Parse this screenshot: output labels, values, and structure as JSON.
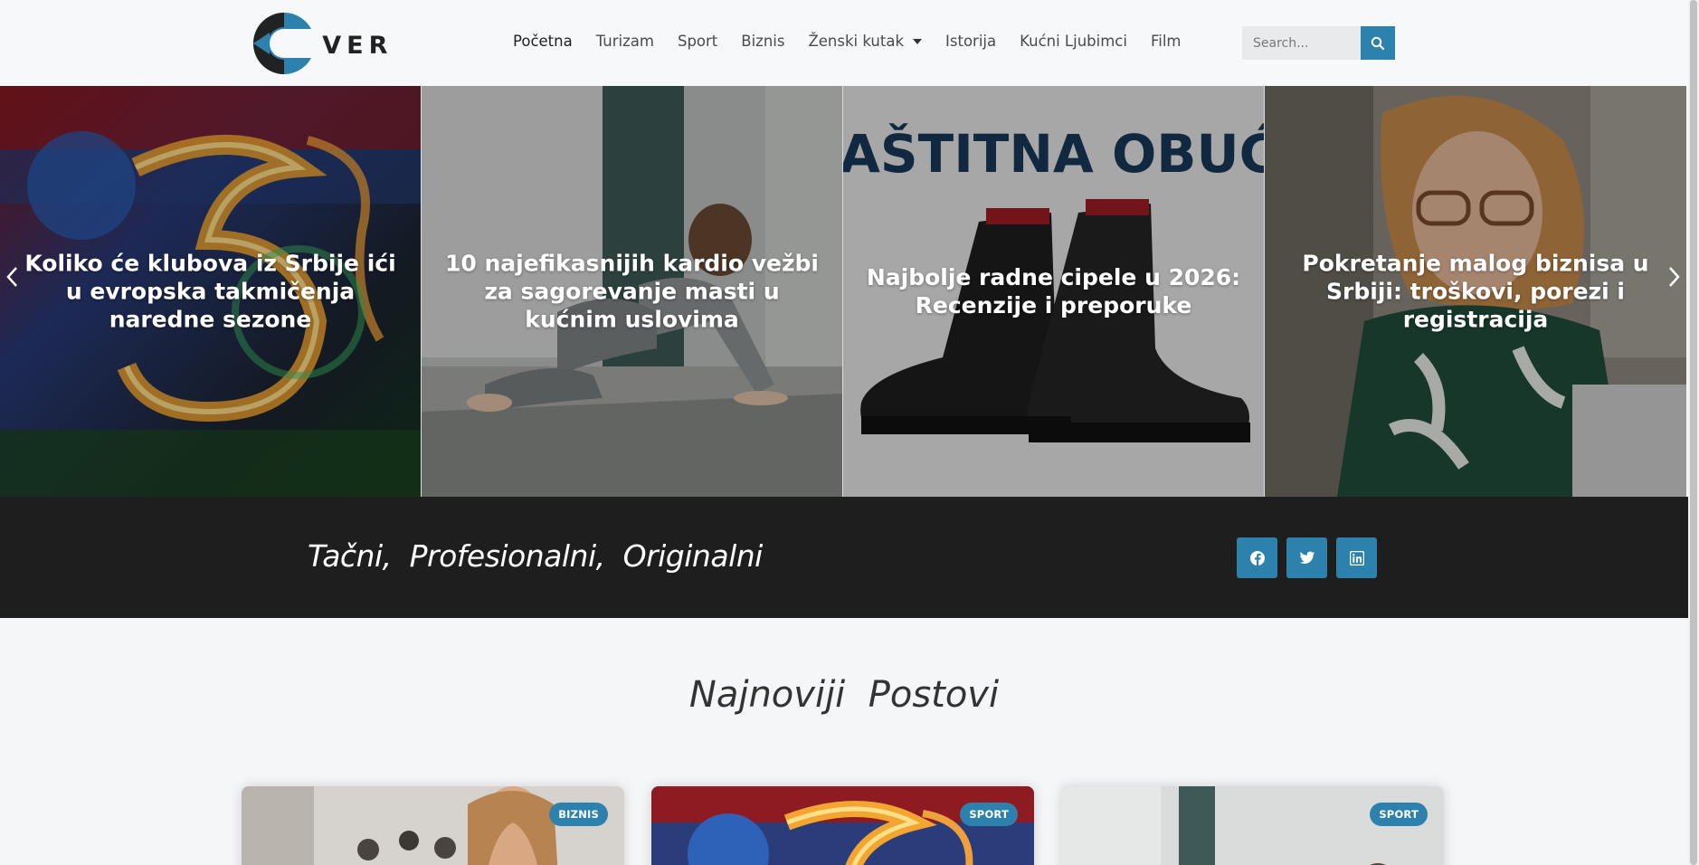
{
  "header": {
    "logo_text": "OVER",
    "nav": [
      {
        "label": "Početna",
        "active": true
      },
      {
        "label": "Turizam"
      },
      {
        "label": "Sport"
      },
      {
        "label": "Biznis"
      },
      {
        "label": "Ženski kutak",
        "dropdown": true
      },
      {
        "label": "Istorija"
      },
      {
        "label": "Kućni Ljubimci"
      },
      {
        "label": "Film"
      }
    ],
    "search": {
      "placeholder": "Search..."
    }
  },
  "slider": {
    "slides": [
      {
        "title": "Koliko će klubova iz Srbije ići u evropska takmičenja naredne sezone",
        "image": "football-champions-league-five"
      },
      {
        "title": "10 najefikasnijih kardio vežbi za sagorevanje masti u kućnim uslovima",
        "image": "woman-home-workout"
      },
      {
        "title": "Najbolje radne cipele u 2026: Recenzije i preporuke",
        "image": "black-work-boots",
        "image_text": "AŠTITNA OBUĆA"
      },
      {
        "title": "Pokretanje malog biznisa u Srbiji: troškovi, porezi i registracija",
        "image": "woman-laptop-glasses"
      }
    ]
  },
  "band": {
    "tagline": "Tačni,  Profesionalni,  Originalni",
    "social": [
      "facebook-icon",
      "twitter-icon",
      "linkedin-icon"
    ]
  },
  "latest": {
    "title": "Najnoviji  Postovi",
    "cards": [
      {
        "badge": "BIZNIS"
      },
      {
        "badge": "SPORT"
      },
      {
        "badge": "SPORT"
      }
    ]
  },
  "colors": {
    "accent": "#2c82ad",
    "band_bg": "#1e1e1e",
    "page_bg": "#f5f6f8"
  }
}
